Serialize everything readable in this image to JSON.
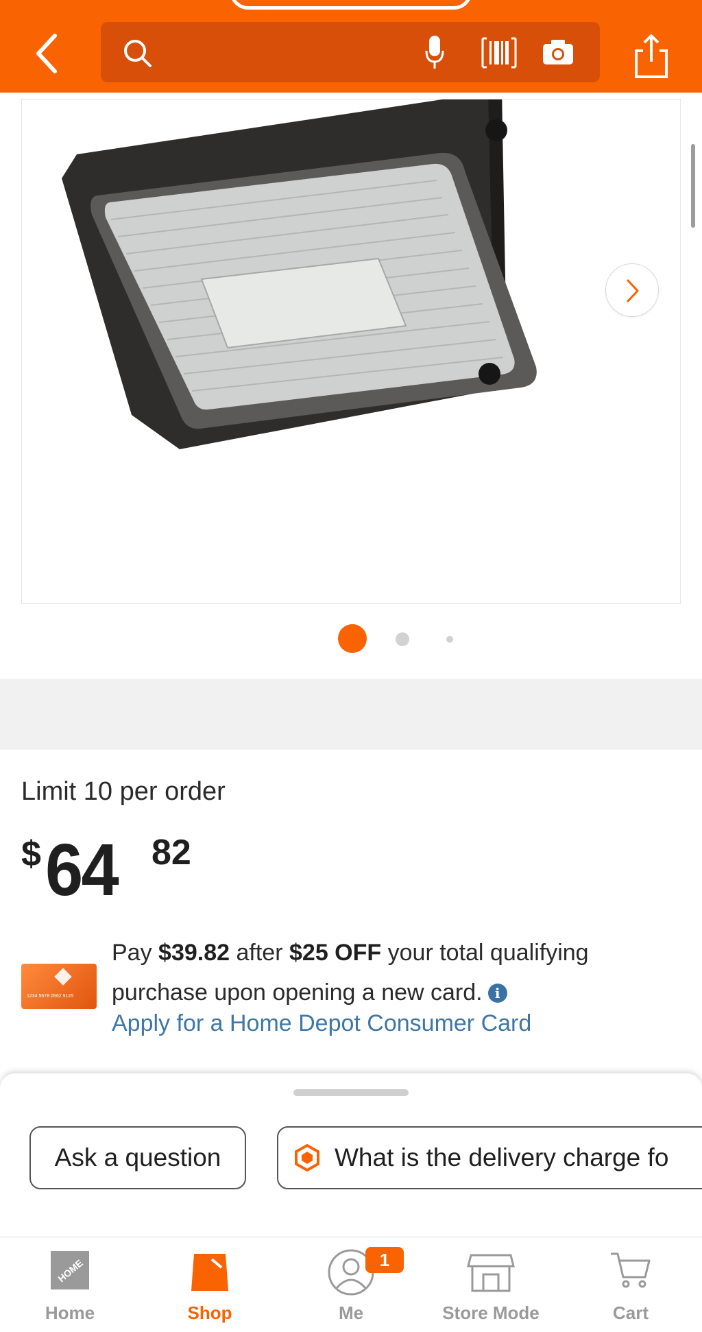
{
  "search": {
    "placeholder": ""
  },
  "image": {
    "current_slide": 1,
    "total_slides": 3
  },
  "pricing": {
    "limit_text": "Limit 10 per order",
    "currency": "$",
    "dollars": "64",
    "cents": "82"
  },
  "promo": {
    "pay_word": "Pay",
    "discounted_price": "$39.82",
    "after_word": "after",
    "discount": "$25 OFF",
    "rest_line1": "your total qualifying",
    "line2": "purchase upon opening a new card.",
    "card_number": "1234 5678 0562 9125",
    "apply_link": "Apply for a Home Depot Consumer Card"
  },
  "chips": {
    "ask": "Ask a question",
    "delivery": "What is the delivery charge fo"
  },
  "tabs": [
    {
      "label": "Home"
    },
    {
      "label": "Shop"
    },
    {
      "label": "Me"
    },
    {
      "label": "Store Mode"
    },
    {
      "label": "Cart"
    }
  ],
  "me_badge": "1",
  "colors": {
    "brand_orange": "#f96302",
    "link_blue": "#3e76a6"
  },
  "icons": [
    "back-arrow-icon",
    "search-icon",
    "microphone-icon",
    "barcode-icon",
    "camera-icon",
    "share-icon",
    "chevron-right-icon",
    "info-icon",
    "sparkle-icon",
    "home-depot-logo-icon",
    "shop-bag-icon",
    "user-icon",
    "store-icon",
    "cart-icon"
  ]
}
